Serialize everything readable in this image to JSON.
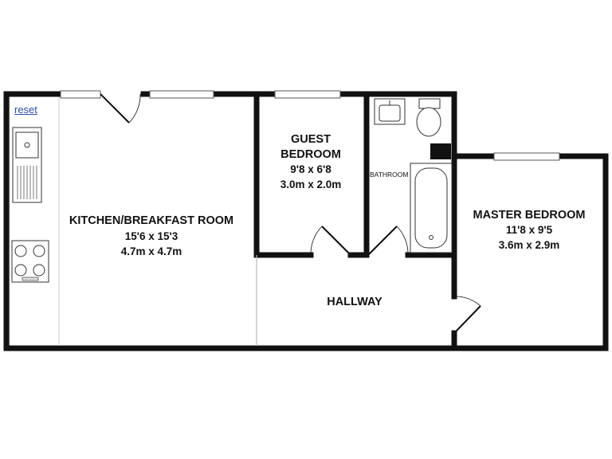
{
  "controls": {
    "reset_label": "reset"
  },
  "rooms": {
    "kitchen": {
      "name": "KITCHEN/BREAKFAST ROOM",
      "imperial": "15'6 x 15'3",
      "metric": "4.7m x 4.7m"
    },
    "guest": {
      "name_line1": "GUEST",
      "name_line2": "BEDROOM",
      "imperial": "9'8 x 6'8",
      "metric": "3.0m x 2.0m"
    },
    "bathroom": {
      "name": "BATHROOM"
    },
    "master": {
      "name": "MASTER BEDROOM",
      "imperial": "11'8 x 9'5",
      "metric": "3.6m x 2.9m"
    },
    "hallway": {
      "name": "HALLWAY"
    }
  },
  "colors": {
    "wall": "#111111",
    "line": "#555555",
    "light_line": "#bbbbbb",
    "link": "#2a4fb0"
  }
}
